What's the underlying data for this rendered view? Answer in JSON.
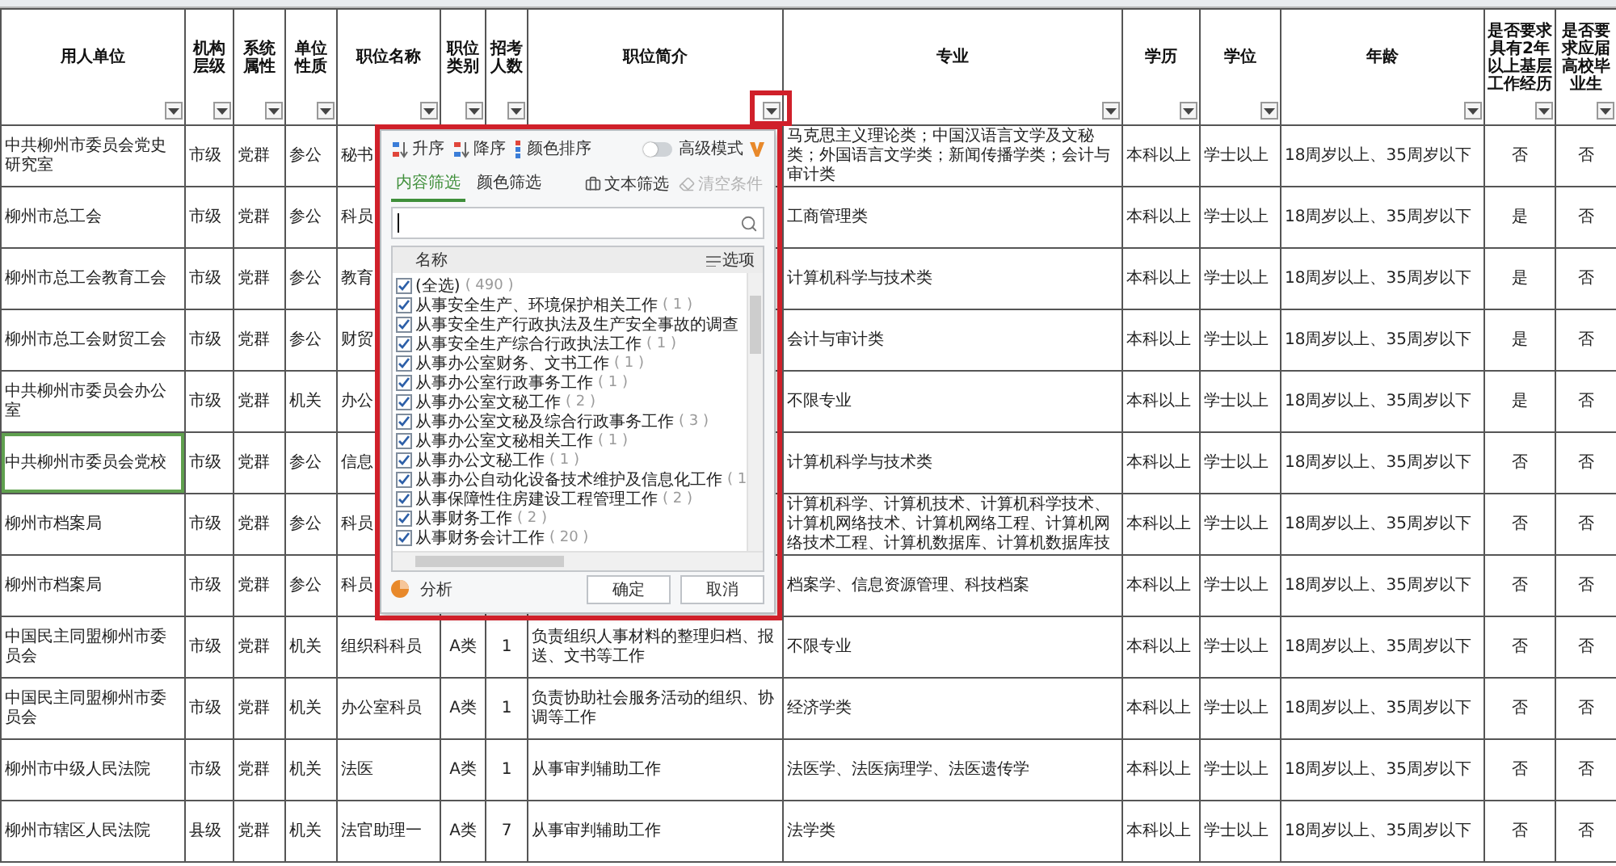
{
  "sheet": {
    "columns": [
      {
        "label": "用人单位"
      },
      {
        "label": "机构层级"
      },
      {
        "label": "系统属性"
      },
      {
        "label": "单位性质"
      },
      {
        "label": "职位名称"
      },
      {
        "label": "职位类别"
      },
      {
        "label": "招考人数"
      },
      {
        "label": "职位简介"
      },
      {
        "label": "专业"
      },
      {
        "label": "学历"
      },
      {
        "label": "学位"
      },
      {
        "label": "年龄"
      },
      {
        "label": "是否要求具有2年以上基层工作经历"
      },
      {
        "label": "是否要求应届高校毕业生"
      }
    ],
    "rows": [
      {
        "unit_cell_selected": false,
        "cells": [
          "中共柳州市委员会党史研究室",
          "市级",
          "党群",
          "参公",
          "秘书",
          null,
          null,
          null,
          "马克思主义理论类；中国汉语言文学及文秘类；外国语言文学类；新闻传播学类；会计与审计类",
          "本科以上",
          "学士以上",
          "18周岁以上、35周岁以下",
          "否",
          "否"
        ]
      },
      {
        "unit_cell_selected": false,
        "cells": [
          "柳州市总工会",
          "市级",
          "党群",
          "参公",
          "科员",
          null,
          null,
          null,
          "工商管理类",
          "本科以上",
          "学士以上",
          "18周岁以上、35周岁以下",
          "是",
          "否"
        ]
      },
      {
        "unit_cell_selected": false,
        "cells": [
          "柳州市总工会教育工会",
          "市级",
          "党群",
          "参公",
          "教育",
          null,
          null,
          null,
          "计算机科学与技术类",
          "本科以上",
          "学士以上",
          "18周岁以上、35周岁以下",
          "是",
          "否"
        ]
      },
      {
        "unit_cell_selected": false,
        "cells": [
          "柳州市总工会财贸工会",
          "市级",
          "党群",
          "参公",
          "财贸",
          null,
          null,
          null,
          "会计与审计类",
          "本科以上",
          "学士以上",
          "18周岁以上、35周岁以下",
          "是",
          "否"
        ]
      },
      {
        "unit_cell_selected": false,
        "cells": [
          "中共柳州市委员会办公室",
          "市级",
          "党群",
          "机关",
          "办公",
          null,
          null,
          null,
          "不限专业",
          "本科以上",
          "学士以上",
          "18周岁以上、35周岁以下",
          "是",
          "否"
        ]
      },
      {
        "unit_cell_selected": true,
        "cells": [
          "中共柳州市委员会党校",
          "市级",
          "党群",
          "参公",
          "信息",
          null,
          null,
          null,
          "计算机科学与技术类",
          "本科以上",
          "学士以上",
          "18周岁以上、35周岁以下",
          "否",
          "否"
        ]
      },
      {
        "unit_cell_selected": false,
        "cells": [
          "柳州市档案局",
          "市级",
          "党群",
          "参公",
          "科员",
          null,
          null,
          null,
          "计算机科学、计算机技术、计算机科学技术、计算机网络技术、计算机网络工程、计算机网络技术工程、计算机数据库、计算机数据库技",
          "本科以上",
          "学士以上",
          "18周岁以上、35周岁以下",
          "否",
          "否"
        ]
      },
      {
        "unit_cell_selected": false,
        "cells": [
          "柳州市档案局",
          "市级",
          "党群",
          "参公",
          "科员",
          null,
          null,
          null,
          "档案学、信息资源管理、科技档案",
          "本科以上",
          "学士以上",
          "18周岁以上、35周岁以下",
          "否",
          "否"
        ]
      },
      {
        "unit_cell_selected": false,
        "cells": [
          "中国民主同盟柳州市委员会",
          "市级",
          "党群",
          "机关",
          "组织科科员",
          "A类",
          "1",
          "负责组织人事材料的整理归档、报送、文书等工作",
          "不限专业",
          "本科以上",
          "学士以上",
          "18周岁以上、35周岁以下",
          "否",
          "否"
        ]
      },
      {
        "unit_cell_selected": false,
        "cells": [
          "中国民主同盟柳州市委员会",
          "市级",
          "党群",
          "机关",
          "办公室科员",
          "A类",
          "1",
          "负责协助社会服务活动的组织、协调等工作",
          "经济学类",
          "本科以上",
          "学士以上",
          "18周岁以上、35周岁以下",
          "否",
          "否"
        ]
      },
      {
        "unit_cell_selected": false,
        "cells": [
          "柳州市中级人民法院",
          "市级",
          "党群",
          "机关",
          "法医",
          "A类",
          "1",
          "从事审判辅助工作",
          "法医学、法医病理学、法医遗传学",
          "本科以上",
          "学士以上",
          "18周岁以上、35周岁以下",
          "否",
          "否"
        ]
      },
      {
        "unit_cell_selected": false,
        "cells": [
          "柳州市辖区人民法院",
          "县级",
          "党群",
          "机关",
          "法官助理一",
          "A类",
          "7",
          "从事审判辅助工作",
          "法学类",
          "本科以上",
          "学士以上",
          "18周岁以上、35周岁以下",
          "否",
          "否"
        ]
      }
    ]
  },
  "filter_popup": {
    "sort": [
      {
        "kind": "asc",
        "label": "升序"
      },
      {
        "kind": "desc",
        "label": "降序"
      },
      {
        "kind": "color",
        "label": "颜色排序"
      }
    ],
    "advanced_mode": {
      "label": "高级模式",
      "on": false
    },
    "tabs": [
      {
        "label": "内容筛选",
        "selected": true
      },
      {
        "label": "颜色筛选",
        "selected": false
      }
    ],
    "actions": [
      {
        "kind": "text",
        "label": "文本筛选",
        "disabled": false
      },
      {
        "kind": "clear",
        "label": "清空条件",
        "disabled": true
      }
    ],
    "list_header": {
      "name": "名称",
      "options": "选项"
    },
    "options": [
      {
        "label": "(全选)",
        "count": "( 490 )",
        "checked": true
      },
      {
        "label": "从事安全生产、环境保护相关工作",
        "count": "( 1 )",
        "checked": true
      },
      {
        "label": "从事安全生产行政执法及生产安全事故的调查",
        "checked": true
      },
      {
        "label": "从事安全生产综合行政执法工作",
        "count": "( 1 )",
        "checked": true
      },
      {
        "label": "从事办公室财务、文书工作",
        "count": "( 1 )",
        "checked": true
      },
      {
        "label": "从事办公室行政事务工作",
        "count": "( 1 )",
        "checked": true
      },
      {
        "label": "从事办公室文秘工作",
        "count": "( 2 )",
        "checked": true
      },
      {
        "label": "从事办公室文秘及综合行政事务工作",
        "count": "( 3 )",
        "checked": true
      },
      {
        "label": "从事办公室文秘相关工作",
        "count": "( 1 )",
        "checked": true
      },
      {
        "label": "从事办公文秘工作",
        "count": "( 1 )",
        "checked": true
      },
      {
        "label": "从事办公自动化设备技术维护及信息化工作",
        "count": "( 1",
        "checked": true
      },
      {
        "label": "从事保障性住房建设工程管理工作",
        "count": "( 2 )",
        "checked": true
      },
      {
        "label": "从事财务工作",
        "count": "( 2 )",
        "checked": true
      },
      {
        "label": "从事财务会计工作",
        "count": "( 20 )",
        "checked": true
      }
    ],
    "analysis": "分析",
    "buttons": [
      "确定",
      "取消"
    ]
  }
}
